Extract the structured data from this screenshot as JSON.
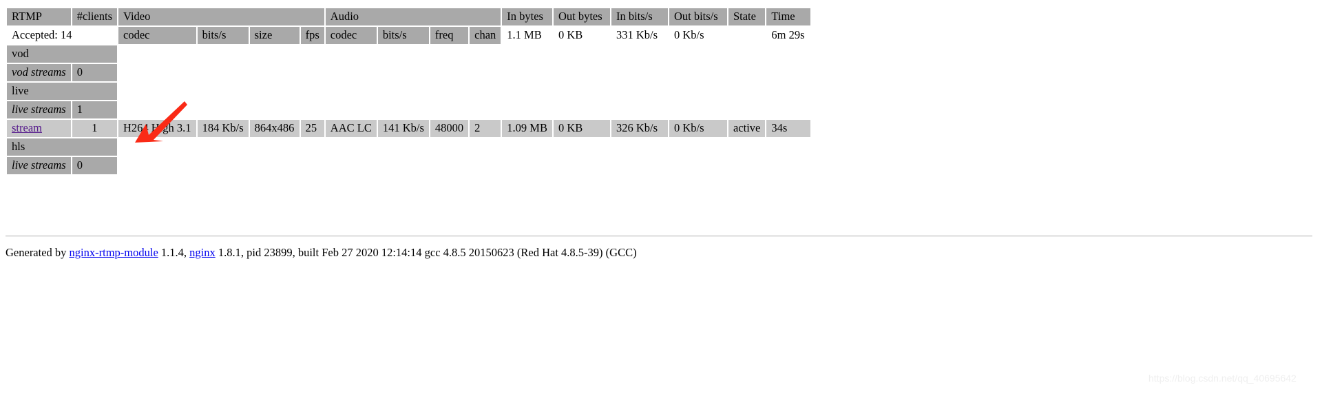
{
  "table": {
    "header_row1": {
      "rtmp": "RTMP",
      "clients": "#clients",
      "video": "Video",
      "audio": "Audio",
      "in_bytes": "In bytes",
      "out_bytes": "Out bytes",
      "in_bits": "In bits/s",
      "out_bits": "Out bits/s",
      "state": "State",
      "time": "Time"
    },
    "header_row2": {
      "accepted": "Accepted: 14",
      "video_codec": "codec",
      "video_bits": "bits/s",
      "video_size": "size",
      "video_fps": "fps",
      "audio_codec": "codec",
      "audio_bits": "bits/s",
      "audio_freq": "freq",
      "audio_chan": "chan",
      "in_bytes": "1.1 MB",
      "out_bytes": "0 KB",
      "in_bits": "331 Kb/s",
      "out_bits": "0 Kb/s",
      "state": "",
      "time": "6m 29s"
    },
    "sections": [
      {
        "name": "vod",
        "streams_label": "vod streams",
        "streams_count": "0",
        "streams": []
      },
      {
        "name": "live",
        "streams_label": "live streams",
        "streams_count": "1",
        "streams": [
          {
            "name": "stream",
            "clients": "1",
            "video_codec": "H264 High 3.1",
            "video_bits": "184 Kb/s",
            "video_size": "864x486",
            "video_fps": "25",
            "audio_codec": "AAC LC",
            "audio_bits": "141 Kb/s",
            "audio_freq": "48000",
            "audio_chan": "2",
            "in_bytes": "1.09 MB",
            "out_bytes": "0 KB",
            "in_bits": "326 Kb/s",
            "out_bits": "0 Kb/s",
            "state": "active",
            "time": "34s"
          }
        ]
      },
      {
        "name": "hls",
        "streams_label": "live streams",
        "streams_count": "0",
        "streams": []
      }
    ]
  },
  "footer": {
    "prefix": "Generated by ",
    "link_module": "nginx-rtmp-module",
    "module_version": " 1.1.4, ",
    "link_nginx": "nginx",
    "tail": " 1.8.1, pid 23899, built Feb 27 2020 12:14:14 gcc 4.8.5 20150623 (Red Hat 4.8.5-39) (GCC)"
  },
  "annotation": {
    "arrow_color": "#fa2a16"
  },
  "watermark": {
    "text": "https://blog.csdn.net/qq_40695642"
  }
}
